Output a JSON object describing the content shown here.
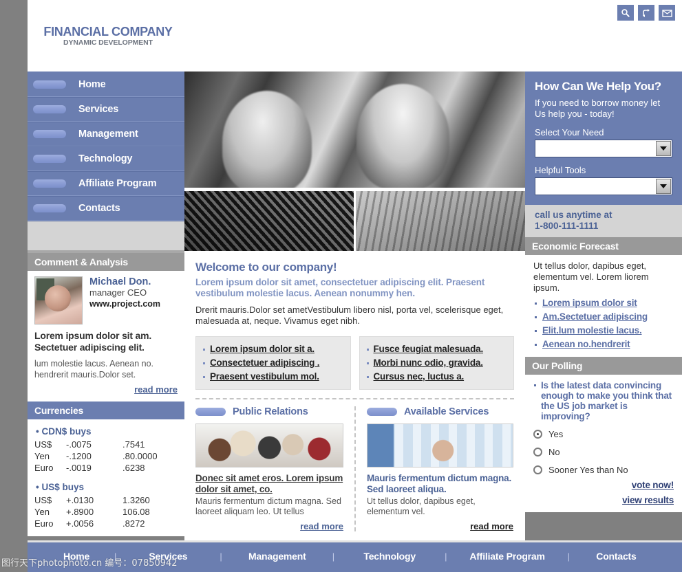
{
  "brand": {
    "name": "FINANCIAL COMPANY",
    "tagline": "DYNAMIC DEVELOPMENT"
  },
  "top_icons": [
    {
      "name": "search-icon",
      "label": "search"
    },
    {
      "name": "sitemap-icon",
      "label": "site map"
    },
    {
      "name": "mail-icon",
      "label": "contact"
    }
  ],
  "nav": {
    "items": [
      {
        "label": "Home"
      },
      {
        "label": "Services"
      },
      {
        "label": "Management"
      },
      {
        "label": "Technology"
      },
      {
        "label": "Affiliate Program"
      },
      {
        "label": "Contacts"
      }
    ]
  },
  "comment_panel": {
    "title": "Comment & Analysis",
    "person_name": "Michael Don.",
    "person_role": "manager CEO",
    "person_site": "www.project.com",
    "lead": "Lorem ipsum dolor sit am. Sectetuer adipiscing elit.",
    "body": "lum molestie lacus. Aenean no. hendrerit mauris.Dolor set.",
    "read_more": "read more"
  },
  "currencies": {
    "title": "Currencies",
    "groups": [
      {
        "heading": "CDN$ buys",
        "rows": [
          {
            "name": "US$",
            "change": "-.0075",
            "rate": ".7541"
          },
          {
            "name": "Yen",
            "change": "-.1200",
            "rate": ".80.0000"
          },
          {
            "name": "Euro",
            "change": "-.0019",
            "rate": ".6238"
          }
        ]
      },
      {
        "heading": "US$ buys",
        "rows": [
          {
            "name": "US$",
            "change": "+.0130",
            "rate": "1.3260"
          },
          {
            "name": "Yen",
            "change": "+.8900",
            "rate": "106.08"
          },
          {
            "name": "Euro",
            "change": "+.0056",
            "rate": ".8272"
          }
        ]
      }
    ]
  },
  "welcome": {
    "title": "Welcome to our company!",
    "lead": "Lorem ipsum dolor sit amet, consectetuer adipiscing elit. Praesent vestibulum molestie lacus. Aenean nonummy hen.",
    "body": "Drerit mauris.Dolor set ametVestibulum libero nisl, porta vel, scelerisque eget, malesuada at, neque. Vivamus eget nibh.",
    "links_left": [
      "Lorem ipsum dolor sit a.",
      "Consectetuer adipiscing .",
      "Praesent vestibulum mol."
    ],
    "links_right": [
      "Fusce feugiat malesuada.",
      "Morbi nunc odio, gravida.",
      "Cursus nec, luctus a."
    ]
  },
  "features": [
    {
      "title": "Public Relations",
      "image_name": "public-relations-photo",
      "lead": "Donec sit amet eros. Lorem ipsum dolor sit amet, co.",
      "body": "Mauris fermentum dictum magna. Sed laoreet aliquam leo. Ut tellus",
      "read_more": "read more"
    },
    {
      "title": "Available Services",
      "image_name": "available-services-photo",
      "lead": "Mauris fermentum dictum magna. Sed laoreet aliqua.",
      "body": "Ut tellus dolor, dapibus eget, elementum vel.",
      "read_more": "read more"
    }
  ],
  "help": {
    "title": "How Can We Help You?",
    "text": "If you need to borrow money let Us help you - today!",
    "select_need_label": "Select Your Need",
    "select_need_value": "",
    "helpful_tools_label": "Helpful Tools",
    "helpful_tools_value": "",
    "call_line1": "call us anytime at",
    "call_line2": "1-800-111-1111"
  },
  "economic_forecast": {
    "title": "Economic Forecast",
    "text": "Ut tellus dolor, dapibus eget, elementum vel. Lorem liorem ipsum.",
    "links": [
      "Lorem ipsum dolor sit",
      "Am.Sectetuer adipiscing",
      "Elit.lum molestie lacus.",
      "Aenean no.hendrerit"
    ]
  },
  "polling": {
    "title": "Our Polling",
    "question": "Is the latest data convincing enough to make you think that the US job market is improving?",
    "options": [
      {
        "label": "Yes",
        "selected": true
      },
      {
        "label": "No",
        "selected": false
      },
      {
        "label": "Sooner Yes than No",
        "selected": false
      }
    ],
    "vote_label": "vote now!",
    "results_label": "view results"
  },
  "footer": {
    "links": [
      "Home",
      "Services",
      "Management",
      "Technology",
      "Affiliate Program",
      "Contacts"
    ],
    "separator": "|"
  },
  "watermark": "图行天下photophoto.cn 编号：07850942",
  "colors": {
    "brand_blue": "#6b7eb0",
    "pill_blue": "#8a9cd4",
    "panel_gray": "#999999",
    "accent_text": "#5b6fa5",
    "page_bg": "#808080"
  }
}
